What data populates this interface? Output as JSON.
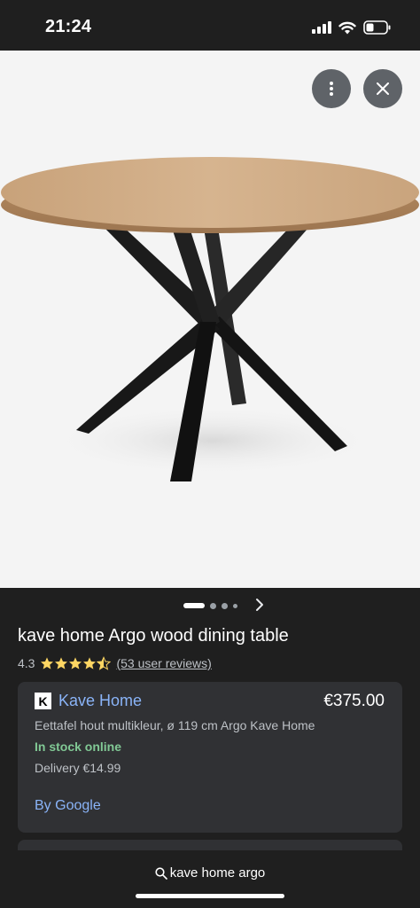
{
  "status_bar": {
    "time": "21:24",
    "icons": [
      "signal-icon",
      "wifi-icon",
      "battery-icon"
    ]
  },
  "image_viewer": {
    "buttons": [
      "more-options-icon",
      "close-icon"
    ],
    "pager": {
      "total_dots": 4,
      "active_index": 0,
      "next_icon": "chevron-right-icon"
    }
  },
  "product": {
    "title": "kave home Argo wood dining table",
    "rating_value": "4.3",
    "rating": 4.3,
    "rating_max": 5,
    "reviews_text": "(53 user reviews)"
  },
  "offers": [
    {
      "seller_logo_letter": "K",
      "seller": "Kave Home",
      "price": "€375.00",
      "description": "Eettafel hout multikleur, ø 119 cm Argo Kave Home",
      "stock": "In stock online",
      "delivery": "Delivery €14.99",
      "by": "By Google"
    }
  ],
  "search": {
    "query": "kave home argo",
    "icon": "search-icon"
  },
  "colors": {
    "background": "#1f1f1f",
    "card": "#303134",
    "link": "#8ab4f8",
    "in_stock": "#81c995",
    "star": "#fdd663"
  }
}
